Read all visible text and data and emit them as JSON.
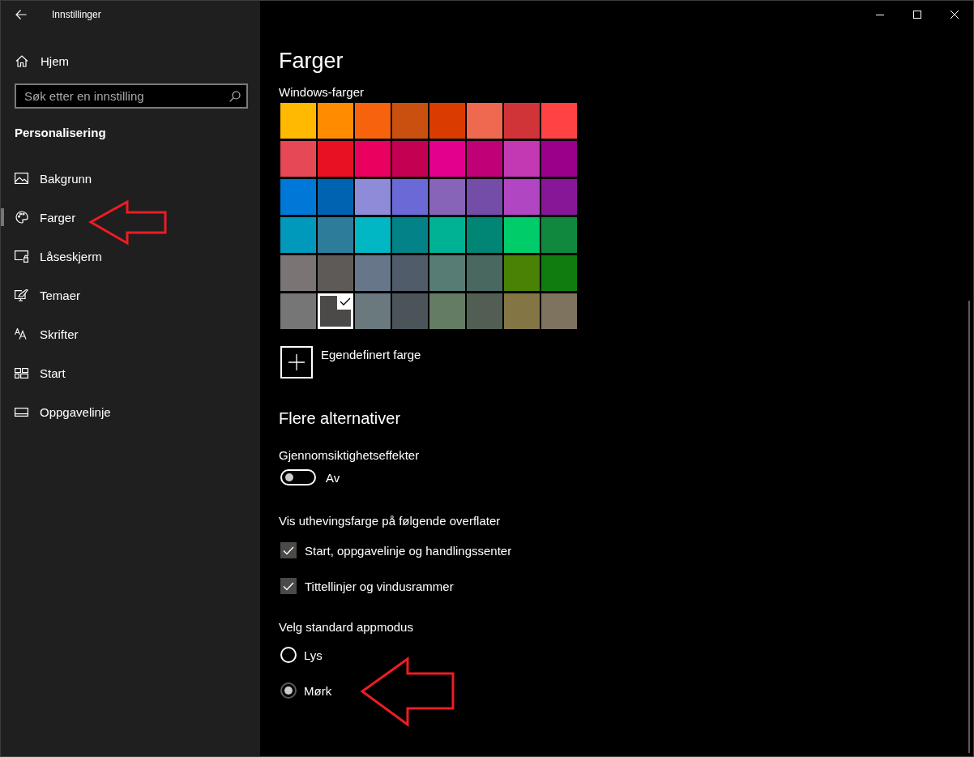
{
  "window": {
    "title": "Innstillinger"
  },
  "sidebar": {
    "home": "Hjem",
    "search": {
      "placeholder": "Søk etter en innstilling"
    },
    "section": "Personalisering",
    "items": [
      {
        "label": "Bakgrunn",
        "selected": false
      },
      {
        "label": "Farger",
        "selected": true
      },
      {
        "label": "Låseskjerm",
        "selected": false
      },
      {
        "label": "Temaer",
        "selected": false
      },
      {
        "label": "Skrifter",
        "selected": false
      },
      {
        "label": "Start",
        "selected": false
      },
      {
        "label": "Oppgavelinje",
        "selected": false
      }
    ]
  },
  "page": {
    "title": "Farger",
    "swatches": {
      "label": "Windows-farger",
      "colors": [
        {
          "color": "#ffb900",
          "selected": false
        },
        {
          "color": "#ff8c00",
          "selected": false
        },
        {
          "color": "#f7630c",
          "selected": false
        },
        {
          "color": "#ca5010",
          "selected": false
        },
        {
          "color": "#da3b01",
          "selected": false
        },
        {
          "color": "#ef6950",
          "selected": false
        },
        {
          "color": "#d13438",
          "selected": false
        },
        {
          "color": "#ff4343",
          "selected": false
        },
        {
          "color": "#e74856",
          "selected": false
        },
        {
          "color": "#e81123",
          "selected": false
        },
        {
          "color": "#ea005e",
          "selected": false
        },
        {
          "color": "#c30052",
          "selected": false
        },
        {
          "color": "#e3008c",
          "selected": false
        },
        {
          "color": "#bf0077",
          "selected": false
        },
        {
          "color": "#c239b3",
          "selected": false
        },
        {
          "color": "#9a0089",
          "selected": false
        },
        {
          "color": "#0078d7",
          "selected": false
        },
        {
          "color": "#0063b1",
          "selected": false
        },
        {
          "color": "#8e8cd8",
          "selected": false
        },
        {
          "color": "#6b69d6",
          "selected": false
        },
        {
          "color": "#8764b8",
          "selected": false
        },
        {
          "color": "#744da9",
          "selected": false
        },
        {
          "color": "#b146c2",
          "selected": false
        },
        {
          "color": "#881798",
          "selected": false
        },
        {
          "color": "#0099bc",
          "selected": false
        },
        {
          "color": "#2d7d9a",
          "selected": false
        },
        {
          "color": "#00b7c3",
          "selected": false
        },
        {
          "color": "#038387",
          "selected": false
        },
        {
          "color": "#00b294",
          "selected": false
        },
        {
          "color": "#018574",
          "selected": false
        },
        {
          "color": "#00cc6a",
          "selected": false
        },
        {
          "color": "#10893e",
          "selected": false
        },
        {
          "color": "#7a7574",
          "selected": false
        },
        {
          "color": "#5d5a58",
          "selected": false
        },
        {
          "color": "#68768a",
          "selected": false
        },
        {
          "color": "#515c6b",
          "selected": false
        },
        {
          "color": "#567c73",
          "selected": false
        },
        {
          "color": "#486860",
          "selected": false
        },
        {
          "color": "#498205",
          "selected": false
        },
        {
          "color": "#107c10",
          "selected": false
        },
        {
          "color": "#767676",
          "selected": false
        },
        {
          "color": "#4c4a48",
          "selected": true
        },
        {
          "color": "#69797e",
          "selected": false
        },
        {
          "color": "#4a5459",
          "selected": false
        },
        {
          "color": "#647c64",
          "selected": false
        },
        {
          "color": "#525e54",
          "selected": false
        },
        {
          "color": "#847545",
          "selected": false
        },
        {
          "color": "#7e735f",
          "selected": false
        }
      ]
    },
    "custom_color": {
      "label": "Egendefinert farge"
    },
    "more_heading": "Flere alternativer",
    "transparency": {
      "label": "Gjennomsiktighetseffekter",
      "on": false,
      "state_text": "Av"
    },
    "accent_surfaces": {
      "label": "Vis uthevingsfarge på følgende overflater",
      "options": [
        {
          "label": "Start, oppgavelinje og handlingssenter",
          "checked": true
        },
        {
          "label": "Tittellinjer og vindusrammer",
          "checked": true
        }
      ]
    },
    "app_mode": {
      "label": "Velg standard appmodus",
      "options": [
        {
          "label": "Lys",
          "selected": false
        },
        {
          "label": "Mørk",
          "selected": true
        }
      ]
    }
  }
}
